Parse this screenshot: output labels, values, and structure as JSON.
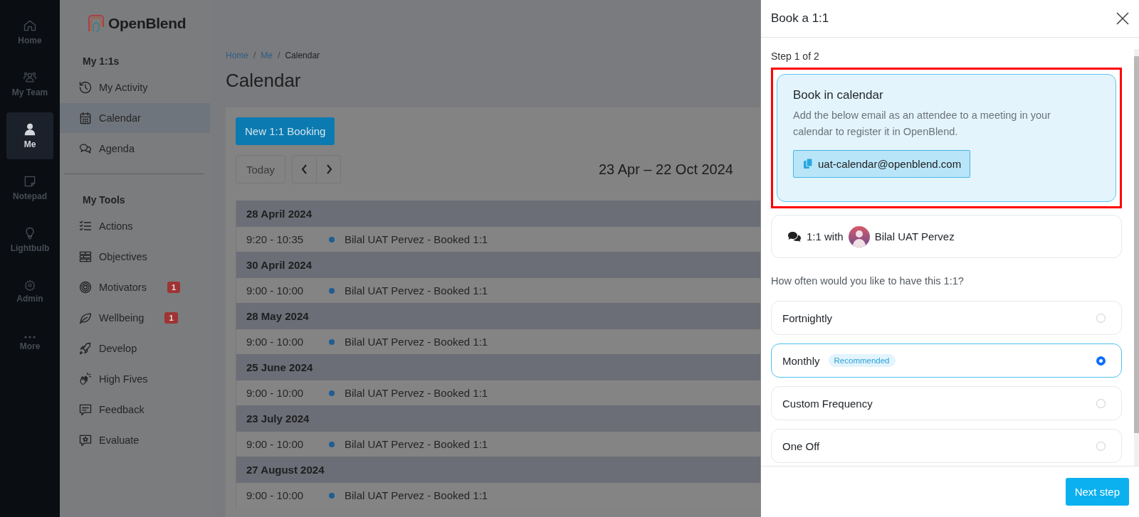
{
  "rail": {
    "items": [
      {
        "label": "Home",
        "selected": false
      },
      {
        "label": "My Team",
        "selected": false
      },
      {
        "label": "Me",
        "selected": true
      },
      {
        "label": "Notepad",
        "selected": false
      },
      {
        "label": "Lightbulb",
        "selected": false
      },
      {
        "label": "Admin",
        "selected": false
      },
      {
        "label": "More",
        "selected": false
      }
    ]
  },
  "sidebar": {
    "logo": "OpenBlend",
    "sections": [
      {
        "title": "My 1:1s",
        "items": [
          {
            "label": "My Activity",
            "selected": false
          },
          {
            "label": "Calendar",
            "selected": true
          },
          {
            "label": "Agenda",
            "selected": false
          }
        ]
      },
      {
        "title": "My Tools",
        "items": [
          {
            "label": "Actions",
            "selected": false
          },
          {
            "label": "Objectives",
            "selected": false
          },
          {
            "label": "Motivators",
            "selected": false,
            "badge": "1"
          },
          {
            "label": "Wellbeing",
            "selected": false,
            "badge": "1"
          },
          {
            "label": "Develop",
            "selected": false
          },
          {
            "label": "High Fives",
            "selected": false
          },
          {
            "label": "Feedback",
            "selected": false
          },
          {
            "label": "Evaluate",
            "selected": false
          }
        ]
      }
    ]
  },
  "main": {
    "breadcrumb": [
      {
        "label": "Home",
        "kind": "link"
      },
      {
        "label": "/",
        "kind": "separator"
      },
      {
        "label": "Me",
        "kind": "link"
      },
      {
        "label": "/",
        "kind": "separator"
      },
      {
        "label": "Calendar",
        "kind": "current"
      }
    ],
    "title": "Calendar",
    "new_button": "New 1:1 Booking",
    "today_button": "Today",
    "date_range": "23 Apr – 22 Oct 2024",
    "agenda": [
      {
        "date": "28 April 2024",
        "events": [
          {
            "time": "9:20 - 10:35",
            "title": "Bilal UAT Pervez - Booked 1:1"
          }
        ]
      },
      {
        "date": "30 April 2024",
        "events": [
          {
            "time": "9:00 - 10:00",
            "title": "Bilal UAT Pervez - Booked 1:1"
          }
        ]
      },
      {
        "date": "28 May 2024",
        "events": [
          {
            "time": "9:00 - 10:00",
            "title": "Bilal UAT Pervez - Booked 1:1"
          }
        ]
      },
      {
        "date": "25 June 2024",
        "events": [
          {
            "time": "9:00 - 10:00",
            "title": "Bilal UAT Pervez - Booked 1:1"
          }
        ]
      },
      {
        "date": "23 July 2024",
        "events": [
          {
            "time": "9:00 - 10:00",
            "title": "Bilal UAT Pervez - Booked 1:1"
          }
        ]
      },
      {
        "date": "27 August 2024",
        "events": [
          {
            "time": "9:00 - 10:00",
            "title": "Bilal UAT Pervez - Booked 1:1"
          }
        ]
      }
    ]
  },
  "drawer": {
    "title": "Book a 1:1",
    "step": "Step 1 of 2",
    "calendar_card": {
      "title": "Book in calendar",
      "text": "Add the below email as an attendee to a meeting in your calendar to register it in OpenBlend.",
      "email": "uat-calendar@openblend.com",
      "highlighted": true
    },
    "with": {
      "prefix": "1:1 with",
      "name": "Bilal UAT Pervez"
    },
    "question": "How often would you like to have this 1:1?",
    "options": [
      {
        "label": "Fortnightly",
        "selected": false
      },
      {
        "label": "Monthly",
        "badge": "Recommended",
        "selected": true
      },
      {
        "label": "Custom Frequency",
        "selected": false
      },
      {
        "label": "One Off",
        "selected": false
      }
    ],
    "next_button": "Next step"
  }
}
